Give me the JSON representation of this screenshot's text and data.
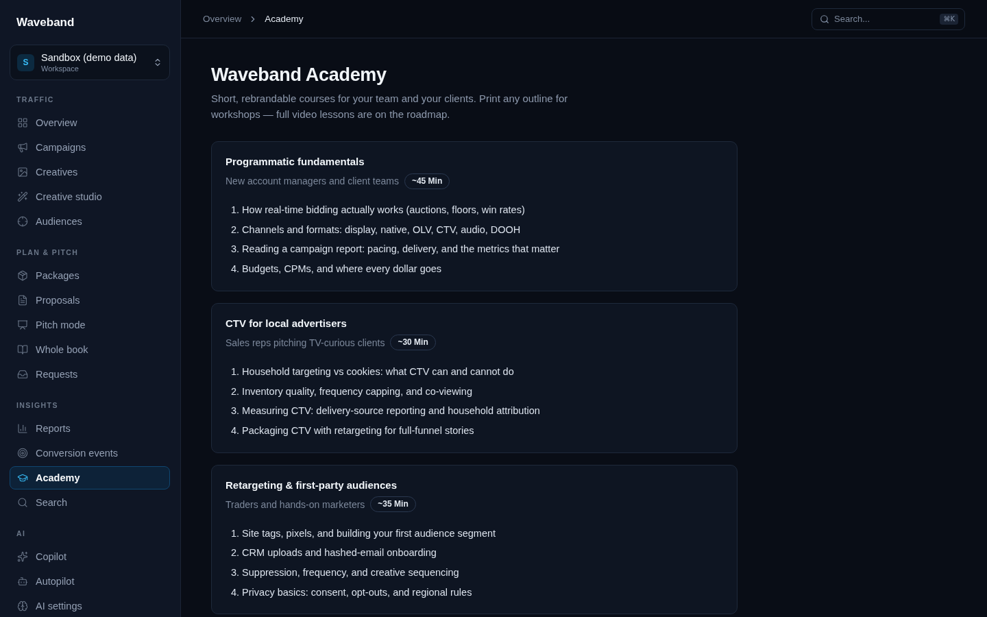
{
  "sidebar": {
    "brand": "Waveband",
    "workspace": {
      "avatar": "S",
      "name": "Sandbox (demo data)",
      "label": "Workspace"
    },
    "sections": [
      {
        "title": "TRAFFIC",
        "items": [
          {
            "label": "Overview",
            "selected": false
          },
          {
            "label": "Campaigns",
            "selected": false
          },
          {
            "label": "Creatives",
            "selected": false
          },
          {
            "label": "Creative studio",
            "selected": false
          },
          {
            "label": "Audiences",
            "selected": false
          }
        ]
      },
      {
        "title": "PLAN & PITCH",
        "items": [
          {
            "label": "Packages",
            "selected": false
          },
          {
            "label": "Proposals",
            "selected": false
          },
          {
            "label": "Pitch mode",
            "selected": false
          },
          {
            "label": "Whole book",
            "selected": false
          },
          {
            "label": "Requests",
            "selected": false
          }
        ]
      },
      {
        "title": "INSIGHTS",
        "items": [
          {
            "label": "Reports",
            "selected": false
          },
          {
            "label": "Conversion events",
            "selected": false
          },
          {
            "label": "Academy",
            "selected": true
          },
          {
            "label": "Search",
            "selected": false
          }
        ]
      },
      {
        "title": "AI",
        "items": [
          {
            "label": "Copilot",
            "selected": false
          },
          {
            "label": "Autopilot",
            "selected": false
          },
          {
            "label": "AI settings",
            "selected": false
          }
        ]
      }
    ]
  },
  "header": {
    "breadcrumb": [
      {
        "label": "Overview",
        "current": false
      },
      {
        "label": "Academy",
        "current": true
      }
    ],
    "search": {
      "placeholder": "Search...",
      "shortcut": "⌘K"
    }
  },
  "page": {
    "title": "Waveband Academy",
    "description": "Short, rebrandable courses for your team and your clients. Print any outline for workshops — full video lessons are on the roadmap.",
    "courses": [
      {
        "title": "Programmatic fundamentals",
        "audience": "New account managers and client teams",
        "duration": "~45 Min",
        "lessons": [
          "1. How real-time bidding actually works (auctions, floors, win rates)",
          "2. Channels and formats: display, native, OLV, CTV, audio, DOOH",
          "3. Reading a campaign report: pacing, delivery, and the metrics that matter",
          "4. Budgets, CPMs, and where every dollar goes"
        ]
      },
      {
        "title": "CTV for local advertisers",
        "audience": "Sales reps pitching TV-curious clients",
        "duration": "~30 Min",
        "lessons": [
          "1. Household targeting vs cookies: what CTV can and cannot do",
          "2. Inventory quality, frequency capping, and co-viewing",
          "3. Measuring CTV: delivery-source reporting and household attribution",
          "4. Packaging CTV with retargeting for full-funnel stories"
        ]
      },
      {
        "title": "Retargeting & first-party audiences",
        "audience": "Traders and hands-on marketers",
        "duration": "~35 Min",
        "lessons": [
          "1. Site tags, pixels, and building your first audience segment",
          "2. CRM uploads and hashed-email onboarding",
          "3. Suppression, frequency, and creative sequencing",
          "4. Privacy basics: consent, opt-outs, and regional rules"
        ]
      }
    ]
  }
}
